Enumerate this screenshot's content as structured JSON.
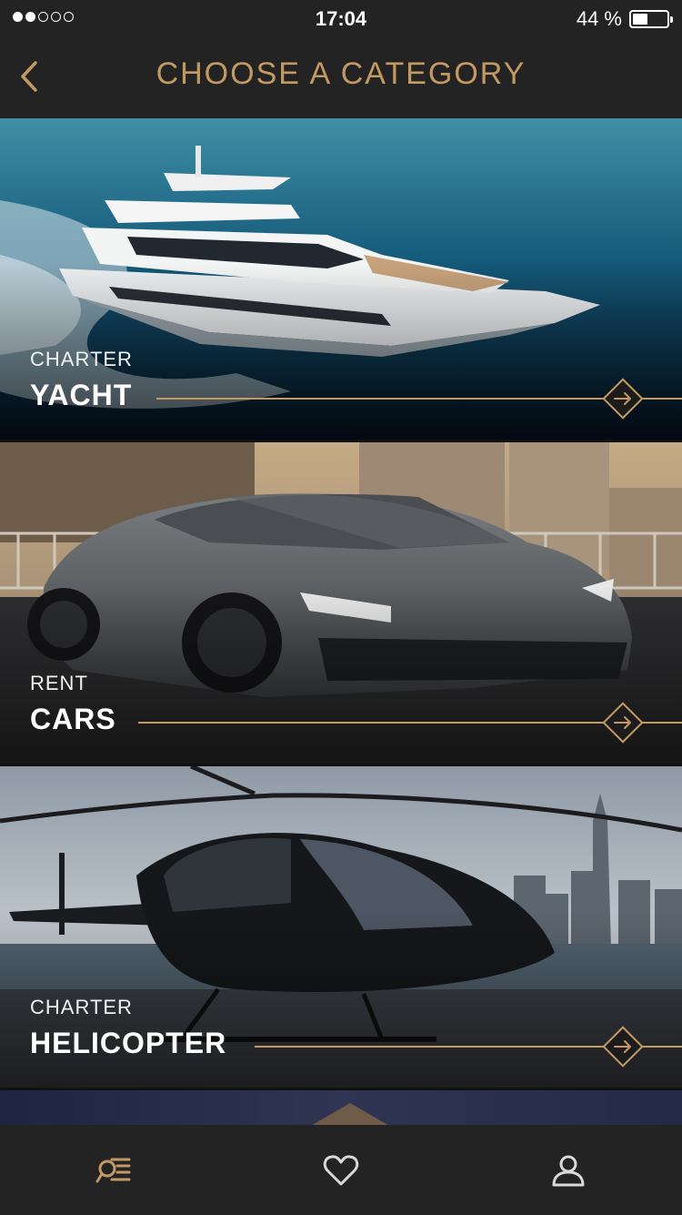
{
  "status_bar": {
    "signal_strength": 2,
    "signal_max": 5,
    "time": "17:04",
    "battery_percent_label": "44 %",
    "battery_level": 0.44
  },
  "header": {
    "back_icon": "chevron-left-icon",
    "title": "CHOOSE A CATEGORY"
  },
  "categories": [
    {
      "subtitle": "CHARTER",
      "title": "YACHT",
      "icon": "diamond-arrow-icon"
    },
    {
      "subtitle": "RENT",
      "title": "CARS",
      "icon": "diamond-arrow-icon"
    },
    {
      "subtitle": "CHARTER",
      "title": "HELICOPTER",
      "icon": "diamond-arrow-icon"
    }
  ],
  "tab_bar": {
    "items": [
      {
        "name": "search-list-icon",
        "active": true
      },
      {
        "name": "heart-icon",
        "active": false
      },
      {
        "name": "profile-icon",
        "active": false
      }
    ]
  },
  "colors": {
    "accent": "#c29a62",
    "bar_background": "#232323",
    "inactive_icon": "#d9d9d9"
  }
}
